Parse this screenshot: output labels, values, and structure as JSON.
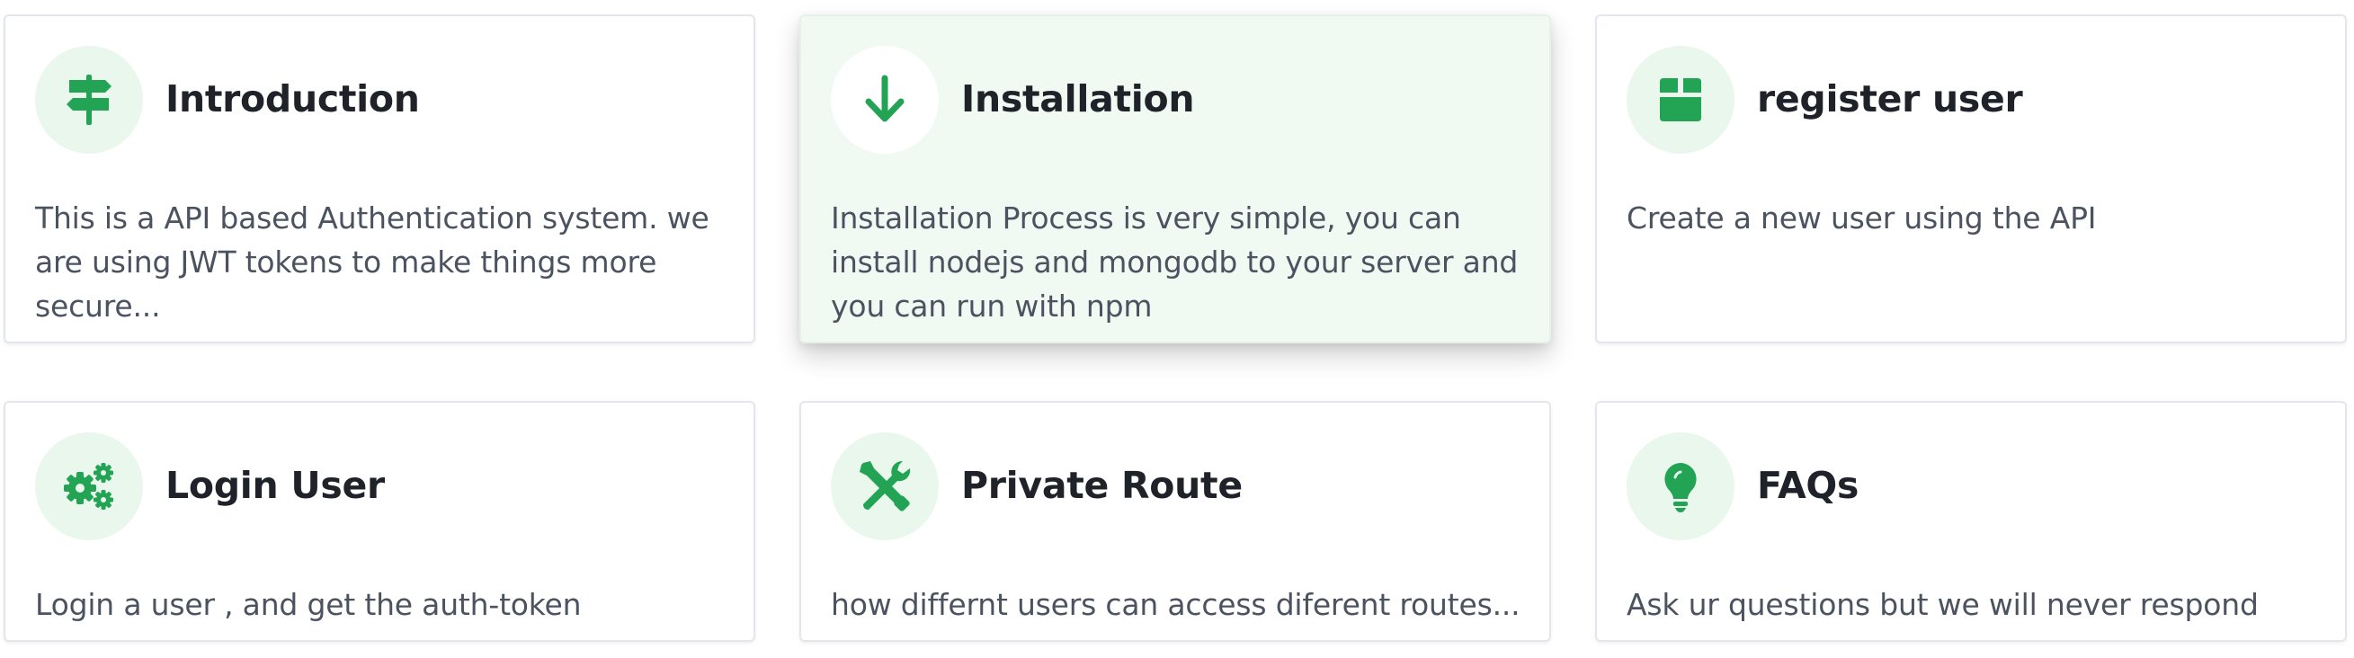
{
  "accent_color": "#23a455",
  "cards": [
    {
      "title": "Introduction",
      "description": "This is a API based Authentication system. we are using JWT tokens to make things more secure...",
      "icon": "signpost-icon"
    },
    {
      "title": "Installation",
      "description": "Installation Process is very simple, you can install nodejs and mongodb to your server and you can run with npm",
      "icon": "arrow-down-icon",
      "active": true
    },
    {
      "title": "register user",
      "description": "Create a new user using the API",
      "icon": "box-icon"
    },
    {
      "title": "Login User",
      "description": "Login a user , and get the auth-token",
      "icon": "gears-icon"
    },
    {
      "title": "Private Route",
      "description": "how differnt users can access diferent routes...",
      "icon": "tools-icon"
    },
    {
      "title": "FAQs",
      "description": "Ask ur questions but we will never respond",
      "icon": "lightbulb-icon"
    }
  ]
}
